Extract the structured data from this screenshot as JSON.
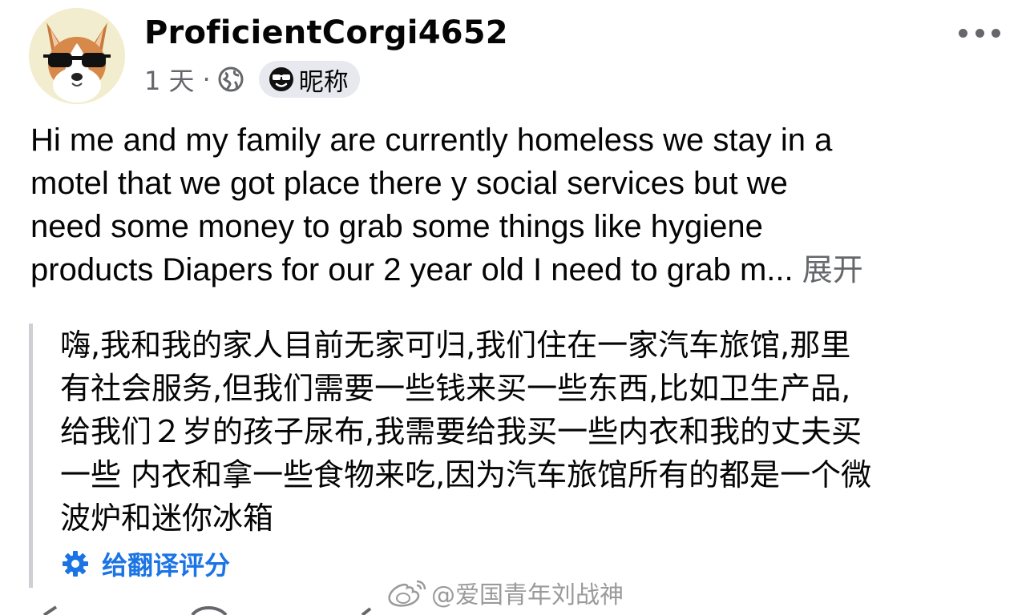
{
  "post": {
    "author": "ProficientCorgi4652",
    "time": "1 天",
    "separator": "·",
    "nickname_label": "昵称",
    "body_lines": [
      "Hi me and my family are currently homeless we stay in a",
      "motel that we got place there y social services  but we",
      "need some money to grab some things like hygiene",
      "products Diapers for our 2 year old I need to grab m..."
    ],
    "see_more": "展开"
  },
  "translation": {
    "lines": [
      "嗨,我和我的家人目前无家可归,我们住在一家汽车旅馆,那里",
      "有社会服务,但我们需要一些钱来买一些东西,比如卫生产品,",
      "给我们２岁的孩子尿布,我需要给我买一些内衣和我的丈夫买",
      "一些 内衣和拿一些食物来吃,因为汽车旅馆所有的都是一个微",
      "波炉和迷你冰箱"
    ],
    "rate_label": "给翻译评分"
  },
  "watermark": {
    "text": "@爱国青年刘战神"
  },
  "icons": {
    "avatar": "corgi-sunglasses-avatar",
    "audience": "globe-icon",
    "nickname": "sunglasses-emoji-icon",
    "more": "more-dots-icon",
    "rate": "gear-icon",
    "watermark_logo": "weibo-logo-icon"
  },
  "colors": {
    "text": "#050505",
    "secondary": "#65676b",
    "link": "#1b74e4",
    "pill": "#e7e9ee",
    "quote_bar": "#ced0d4"
  }
}
